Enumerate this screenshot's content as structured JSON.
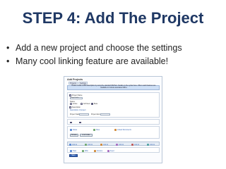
{
  "slide": {
    "title": "STEP 4: Add The Project",
    "bullets": [
      "Add a new project and choose the settings",
      "Many cool linking feature are available!"
    ]
  },
  "screenshot": {
    "title": "Add Projects",
    "tabs": [
      "Projects",
      "Settings"
    ],
    "info": "Please create a Wiki description by using the standard WikiText. Details on the syntax here. Other useful features are available to include associated URLs",
    "fields": {
      "project_name_label": "Project Name",
      "project_name_value": "Project Hello",
      "status_label": "Status",
      "status_options": [
        "Active",
        "Archived",
        "Beta"
      ],
      "description_label": "Description",
      "description_value": "Description of project",
      "project_start_label": "Project Start",
      "project_end_label": "Project End"
    },
    "attachments": [
      "Notes",
      "Files",
      "Linked Documents"
    ],
    "link_buttons": [
      "Browse",
      "Link Folder"
    ],
    "toolbar_items": [
      "Link to",
      "Link to",
      "Link to",
      "Link to",
      "Link to",
      "Link to"
    ],
    "bottom_links": [
      "Task",
      "Wiki",
      "Forums",
      "Feed"
    ],
    "save_label": "Save"
  },
  "colors": {
    "title": "#1f3864",
    "info_bar": "#cfe0f6",
    "save_button": "#3366bb"
  }
}
